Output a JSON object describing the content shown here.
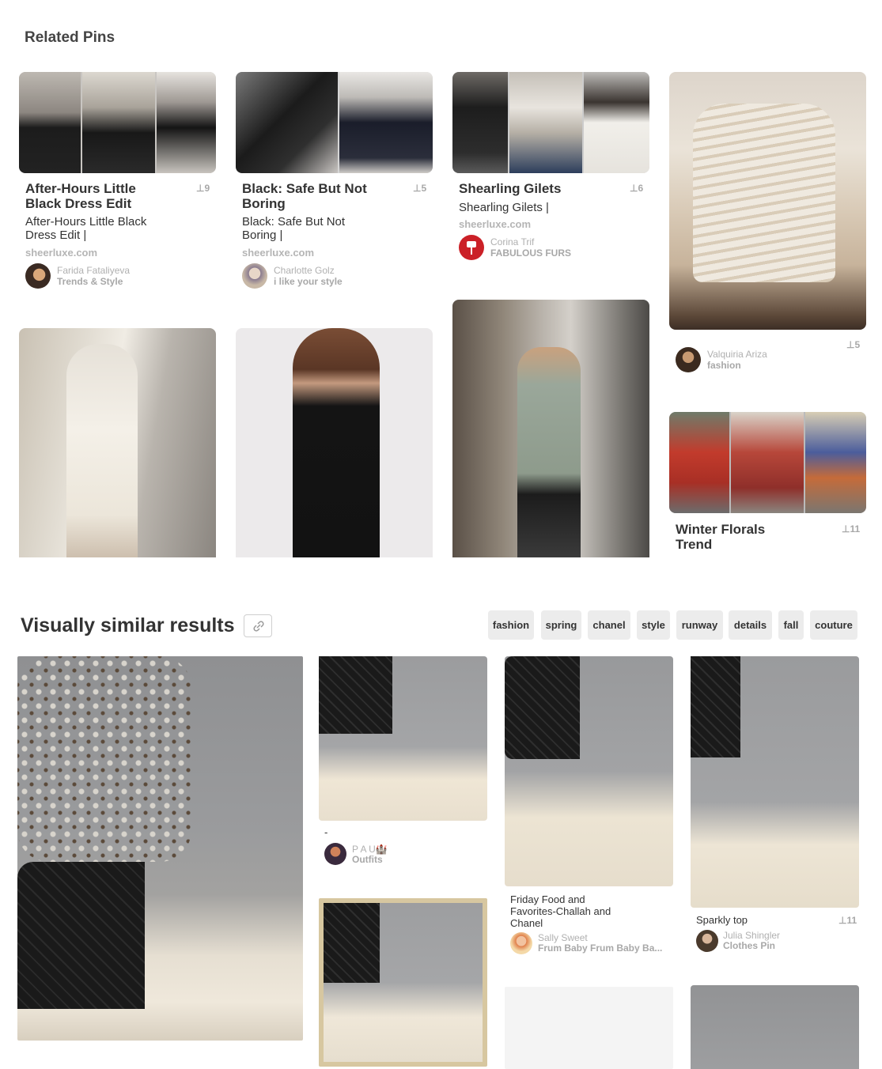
{
  "related_pins": {
    "heading": "Related Pins",
    "pins": [
      {
        "title": "After-Hours Little Black Dress Edit",
        "repins": "9",
        "description": "After-Hours Little Black Dress Edit |",
        "domain": "sheerluxe.com",
        "pinner": "Farida Fataliyeva",
        "board": "Trends & Style"
      },
      {
        "title": "Black: Safe But Not Boring",
        "repins": "5",
        "description": "Black: Safe But Not Boring |",
        "domain": "sheerluxe.com",
        "pinner": "Charlotte Golz",
        "board": "i like your style"
      },
      {
        "title": "Shearling Gilets",
        "repins": "6",
        "description": "Shearling Gilets |",
        "domain": "sheerluxe.com",
        "pinner": "Corina Trif",
        "board": "FABULOUS FURS"
      },
      {
        "title": "",
        "repins": "5",
        "pinner": "Valquiria Ariza",
        "board": "fashion"
      },
      {
        "title": "Winter Florals Trend",
        "repins": "11"
      }
    ]
  },
  "visually_similar": {
    "heading": "Visually similar results",
    "tags": [
      "fashion",
      "spring",
      "chanel",
      "style",
      "runway",
      "details",
      "fall",
      "couture"
    ],
    "pins": [
      {
        "description": "-",
        "pinner": "P A U🏰",
        "board": "Outfits"
      },
      {
        "description": "Friday Food and Favorites-Challah and Chanel",
        "pinner": "Sally Sweet",
        "board": "Frum Baby Frum Baby Ba..."
      },
      {
        "description": "Sparkly top",
        "repins": "11",
        "pinner": "Julia Shingler",
        "board": "Clothes Pin"
      }
    ]
  },
  "icons": {
    "repin": "pushpin-icon",
    "link": "link-icon",
    "pinterest": "pinterest-pin-icon"
  },
  "colors": {
    "tag_bg": "#ececec",
    "pin_red": "#cb2027",
    "muted_text": "#b0b0b0"
  }
}
